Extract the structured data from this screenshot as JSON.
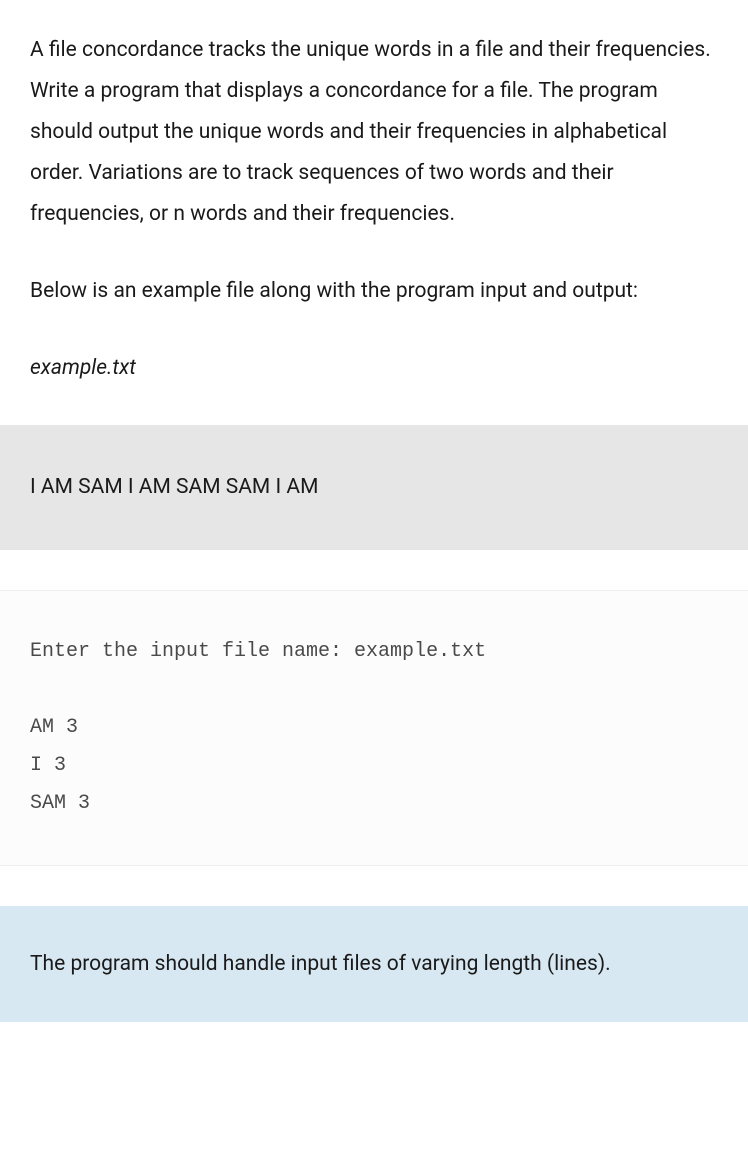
{
  "intro": "A file concordance tracks the unique words in a file and their frequencies. Write a program that displays a concordance for a file. The program should output the unique words and their frequencies in alphabetical order. Variations are to track sequences of two words and their frequencies, or n words and their frequencies.",
  "subtext": "Below is an example file along with the program input and output:",
  "filename": "example.txt",
  "file_contents": "I AM SAM I AM SAM SAM I AM",
  "program_io": "Enter the input file name: example.txt\n\nAM 3\nI 3\nSAM 3",
  "note": "The program should handle input files of varying length (lines)."
}
